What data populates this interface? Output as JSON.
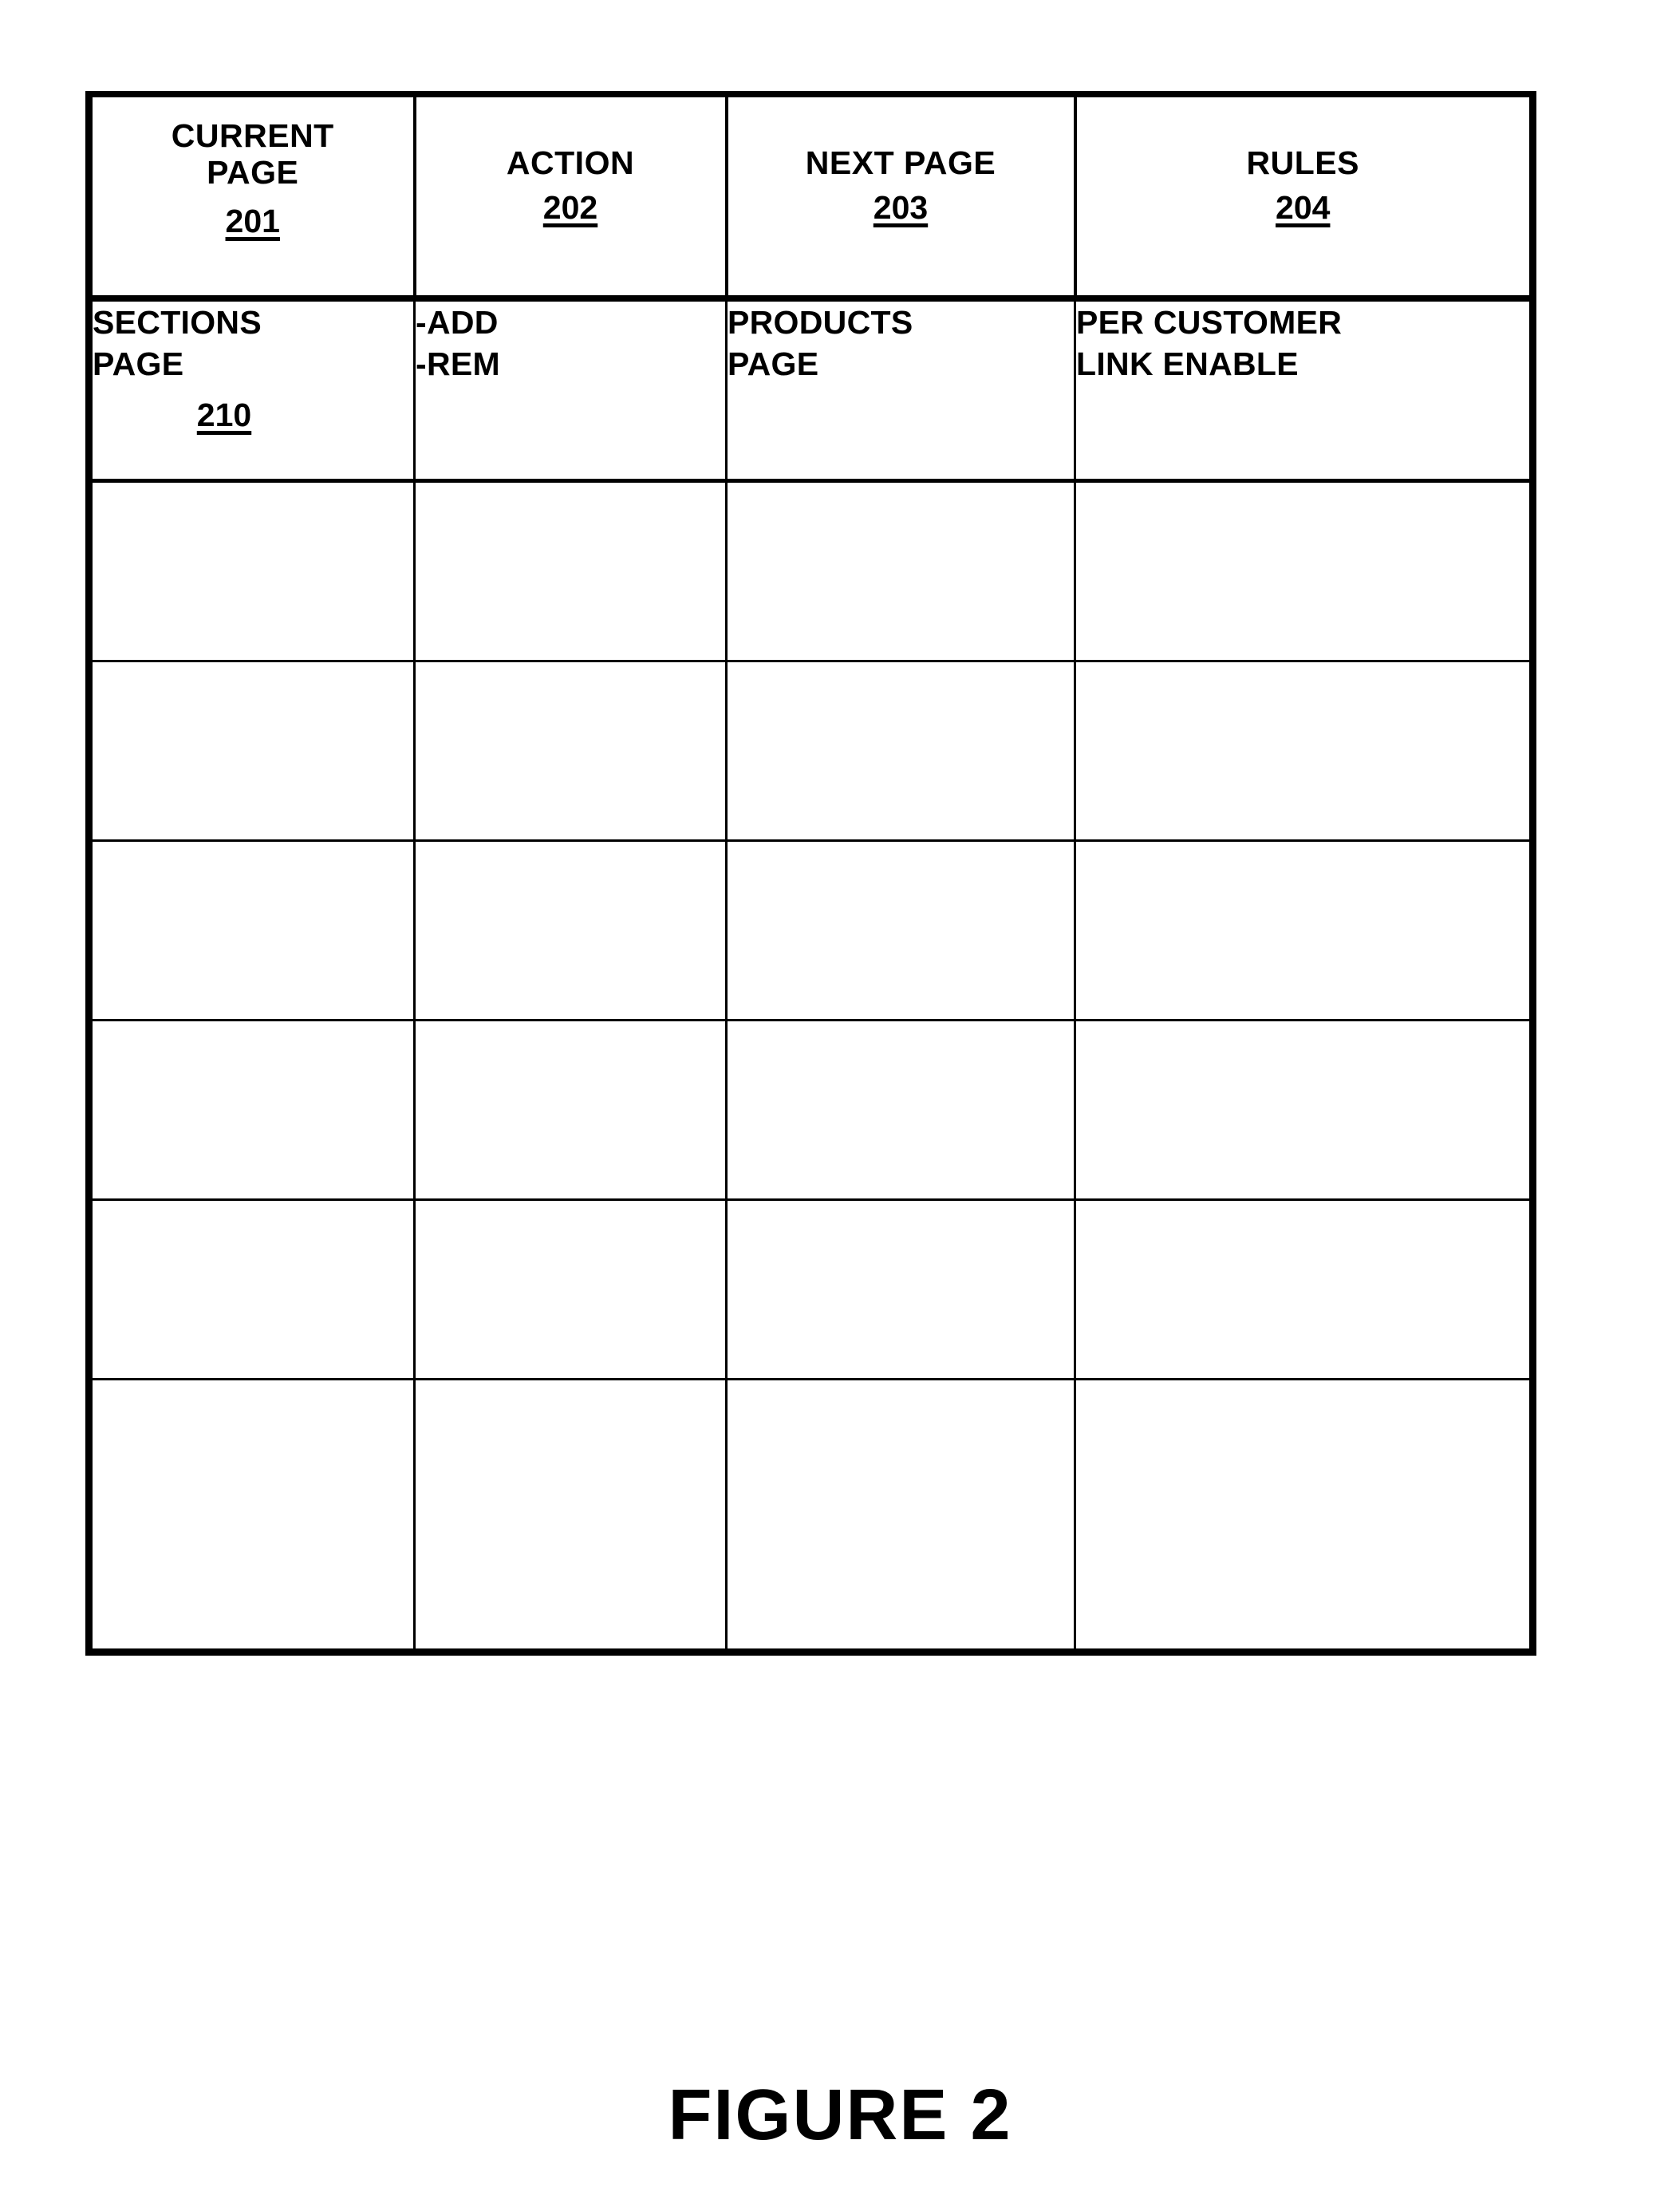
{
  "document": {
    "figure_caption": "FIGURE 2",
    "background_color": "#ffffff",
    "line_color": "#000000"
  },
  "table": {
    "columns": [
      {
        "key": "current_page",
        "header_label": "CURRENT\nPAGE",
        "header_ref": "201"
      },
      {
        "key": "action",
        "header_label": "ACTION",
        "header_ref": "202"
      },
      {
        "key": "next_page",
        "header_label": "NEXT PAGE",
        "header_ref": "203"
      },
      {
        "key": "rules",
        "header_label": "RULES",
        "header_ref": "204"
      }
    ],
    "rows": [
      {
        "type": "data",
        "cells": {
          "current_page": {
            "text": "SECTIONS\nPAGE",
            "ref": "210"
          },
          "action": {
            "text": "-ADD\n-REM",
            "ref": ""
          },
          "next_page": {
            "text": "PRODUCTS\nPAGE",
            "ref": ""
          },
          "rules": {
            "text": "PER CUSTOMER\nLINK ENABLE",
            "ref": ""
          }
        }
      },
      {
        "type": "empty",
        "cells": {
          "current_page": {
            "text": ""
          },
          "action": {
            "text": ""
          },
          "next_page": {
            "text": ""
          },
          "rules": {
            "text": ""
          }
        }
      },
      {
        "type": "empty",
        "cells": {
          "current_page": {
            "text": ""
          },
          "action": {
            "text": ""
          },
          "next_page": {
            "text": ""
          },
          "rules": {
            "text": ""
          }
        }
      },
      {
        "type": "empty",
        "cells": {
          "current_page": {
            "text": ""
          },
          "action": {
            "text": ""
          },
          "next_page": {
            "text": ""
          },
          "rules": {
            "text": ""
          }
        }
      },
      {
        "type": "empty",
        "cells": {
          "current_page": {
            "text": ""
          },
          "action": {
            "text": ""
          },
          "next_page": {
            "text": ""
          },
          "rules": {
            "text": ""
          }
        }
      },
      {
        "type": "empty",
        "cells": {
          "current_page": {
            "text": ""
          },
          "action": {
            "text": ""
          },
          "next_page": {
            "text": ""
          },
          "rules": {
            "text": ""
          }
        }
      },
      {
        "type": "empty-tall",
        "cells": {
          "current_page": {
            "text": ""
          },
          "action": {
            "text": ""
          },
          "next_page": {
            "text": ""
          },
          "rules": {
            "text": ""
          }
        }
      }
    ]
  }
}
